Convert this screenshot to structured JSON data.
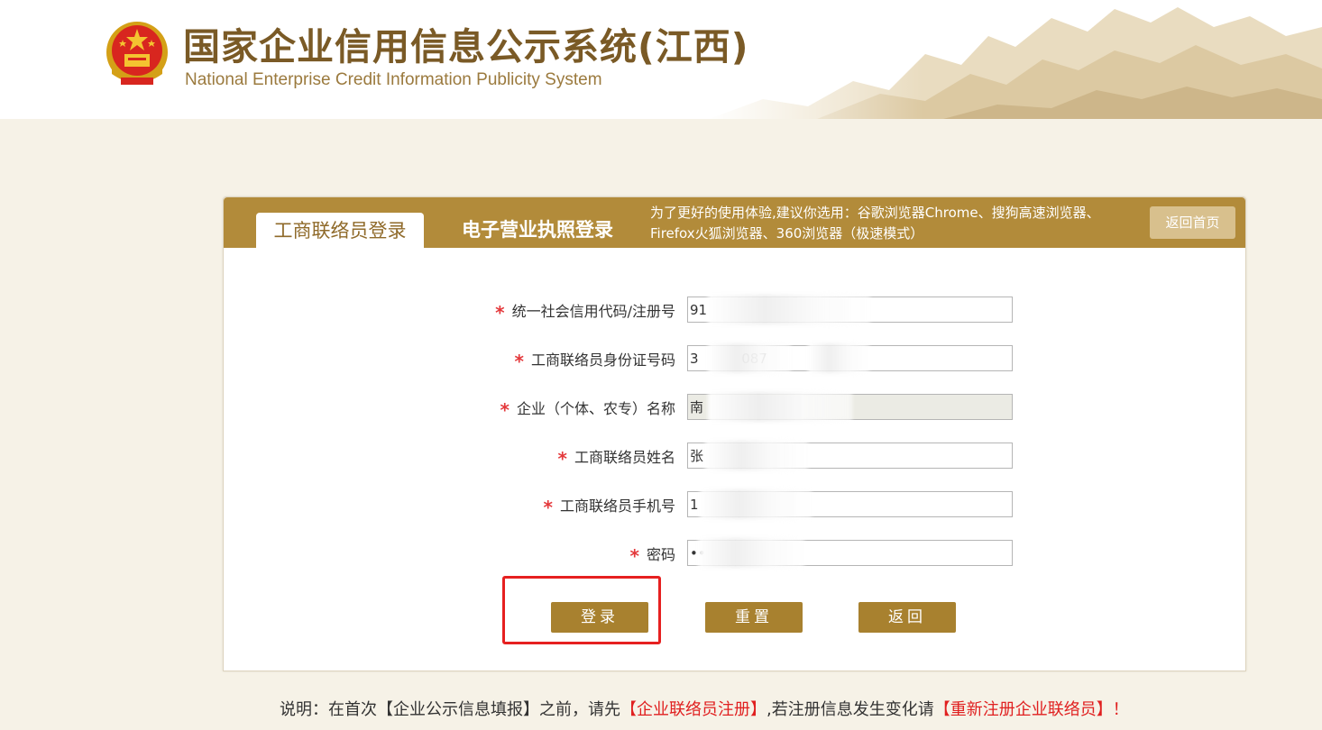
{
  "header": {
    "title": "国家企业信用信息公示系统(江西)",
    "subtitle": "National Enterprise Credit Information Publicity System"
  },
  "tabs": {
    "active_label": "工商联络员登录",
    "inactive_label": "电子营业执照登录",
    "browser_tip": "为了更好的使用体验,建议你选用：谷歌浏览器Chrome、搜狗高速浏览器、Firefox火狐浏览器、360浏览器（极速模式）",
    "home_label": "返回首页"
  },
  "form": {
    "fields": [
      {
        "label": "统一社会信用代码/注册号",
        "value": "91"
      },
      {
        "label": "工商联络员身份证号码",
        "value": "3          087"
      },
      {
        "label": "企业（个体、农专）名称",
        "value": "南"
      },
      {
        "label": "工商联络员姓名",
        "value": "张"
      },
      {
        "label": "工商联络员手机号",
        "value": "1"
      },
      {
        "label": "密码",
        "value": "••"
      }
    ],
    "required_mark": "*"
  },
  "buttons": {
    "login": "登录",
    "reset": "重置",
    "back": "返回"
  },
  "note": {
    "prefix": "说明：在首次【企业公示信息填报】之前，请先",
    "link1": "【企业联络员注册】",
    "middle": ",若注册信息发生变化请",
    "link2": "【重新注册企业联络员】",
    "suffix": "！"
  },
  "colors": {
    "accent": "#b28b3a",
    "button": "#a8812f",
    "highlight": "#e62020",
    "required": "#e4393c"
  }
}
